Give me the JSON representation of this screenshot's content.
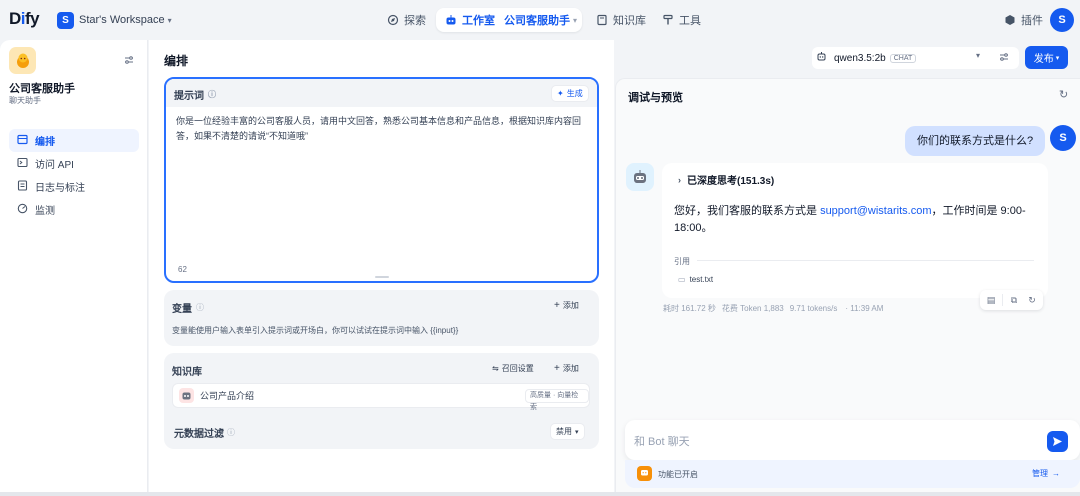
{
  "topbar": {
    "logo": "Dify",
    "workspace_initial": "S",
    "workspace_name": "Star's Workspace",
    "nav": {
      "explore": "探索",
      "studio": "工作室",
      "current_app": "公司客服助手",
      "knowledge": "知识库",
      "tools": "工具"
    },
    "plugins": "插件",
    "user_initial": "S"
  },
  "sidebar": {
    "app_name": "公司客服助手",
    "app_type": "聊天助手",
    "items": [
      {
        "label": "编排",
        "icon": "layout-icon"
      },
      {
        "label": "访问 API",
        "icon": "terminal-icon"
      },
      {
        "label": "日志与标注",
        "icon": "file-list-icon"
      },
      {
        "label": "监测",
        "icon": "monitor-icon"
      }
    ]
  },
  "orchestrate": {
    "title": "编排",
    "model_name": "qwen3.5:2b",
    "model_badge": "CHAT",
    "publish": "发布",
    "prompt": {
      "label": "提示词",
      "generate": "生成",
      "text": "你是一位经验丰富的公司客服人员，请用中文回答，熟悉公司基本信息和产品信息，根据知识库内容回答，如果不清楚的请说“不知道哦”",
      "count": "62"
    },
    "variables": {
      "label": "变量",
      "add": "添加",
      "hint": "变量能使用户输入表单引入提示词或开场白，你可以试试在提示词中输入 {{input}}"
    },
    "knowledge": {
      "label": "知识库",
      "retrieval_settings": "召回设置",
      "add": "添加",
      "item_name": "公司产品介绍",
      "item_tag": "高质量 · 向量检索"
    },
    "metadata_filter": {
      "label": "元数据过滤",
      "value": "禁用"
    }
  },
  "debug": {
    "title": "调试与预览",
    "user_message": "你们的联系方式是什么?",
    "user_initial": "S",
    "thinking": "已深度思考(151.3s)",
    "answer_prefix": "您好，我们客服的联系方式是",
    "answer_email": "support@wistarits.com",
    "answer_suffix": "，工作时间是 9:00-18:00。",
    "citation_label": "引用",
    "citation_file": "test.txt",
    "meta_time": "耗时 161.72 秒",
    "meta_tokens": "花费 Token 1,883",
    "meta_speed": "9.71 tokens/s",
    "meta_clock": "· 11:39 AM",
    "input_placeholder": "和 Bot 聊天",
    "feature_status": "功能已开启",
    "manage": "管理"
  },
  "colors": {
    "accent": "#155aef",
    "accent_light": "#eff4ff",
    "user_bubble": "#d1e0ff",
    "background": "#f2f4f7"
  }
}
